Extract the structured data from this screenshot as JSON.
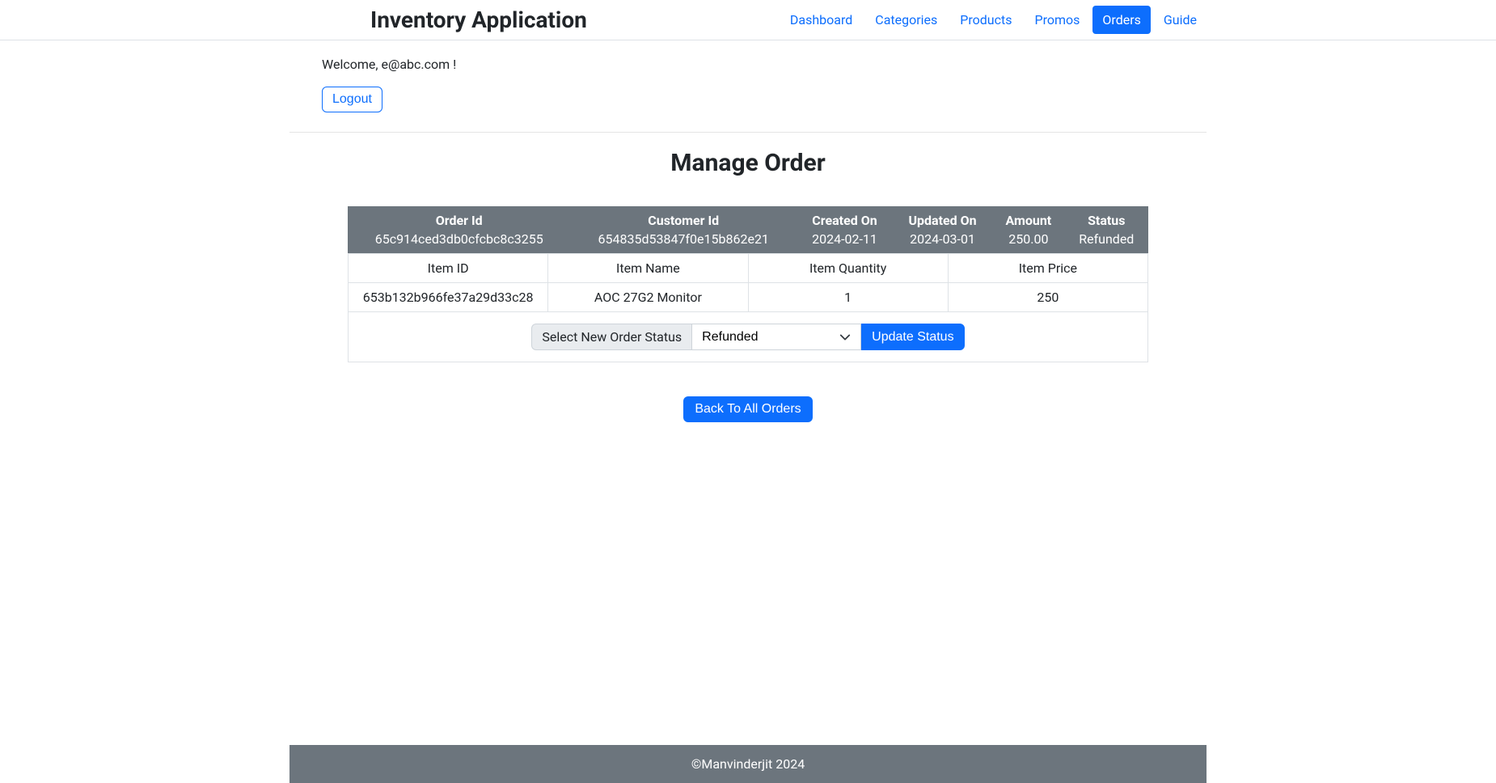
{
  "brand": "Inventory Application",
  "nav": {
    "dashboard": "Dashboard",
    "categories": "Categories",
    "products": "Products",
    "promos": "Promos",
    "orders": "Orders",
    "guide": "Guide"
  },
  "welcome_text": "Welcome, e@abc.com !",
  "logout_label": "Logout",
  "page_title": "Manage Order",
  "order_headers": {
    "order_id": "Order Id",
    "customer_id": "Customer Id",
    "created_on": "Created On",
    "updated_on": "Updated On",
    "amount": "Amount",
    "status": "Status"
  },
  "order": {
    "order_id": "65c914ced3db0cfcbc8c3255",
    "customer_id": "654835d53847f0e15b862e21",
    "created_on": "2024-02-11",
    "updated_on": "2024-03-01",
    "amount": "250.00",
    "status": "Refunded"
  },
  "item_headers": {
    "item_id": "Item ID",
    "item_name": "Item Name",
    "item_quantity": "Item Quantity",
    "item_price": "Item Price"
  },
  "items": [
    {
      "id": "653b132b966fe37a29d33c28",
      "name": "AOC 27G2 Monitor",
      "quantity": "1",
      "price": "250"
    }
  ],
  "status_form": {
    "label": "Select New Order Status",
    "selected": "Refunded",
    "update_label": "Update Status"
  },
  "back_label": "Back To All Orders",
  "footer": "©Manvinderjit 2024"
}
